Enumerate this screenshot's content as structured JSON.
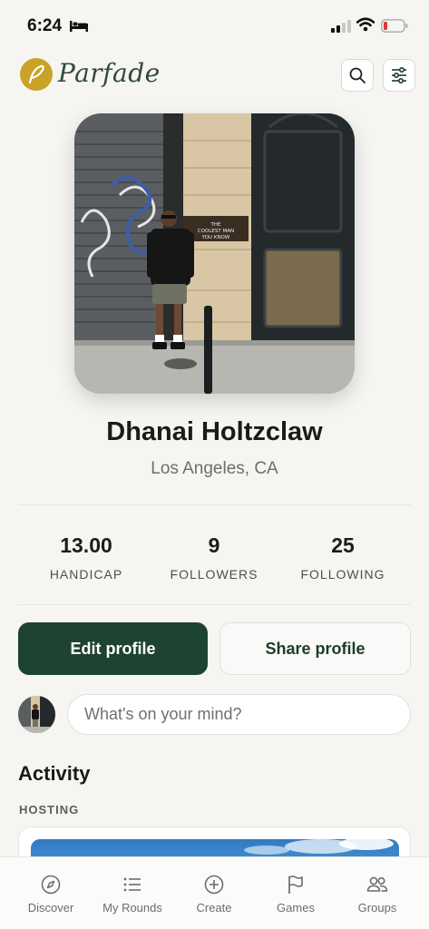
{
  "status_bar": {
    "time": "6:24"
  },
  "app": {
    "name": "Parfade"
  },
  "profile": {
    "name": "Dhanai Holtzclaw",
    "location": "Los Angeles, CA",
    "photo_sign_text": "THE COOLEST MAN YOU KNOW"
  },
  "stats": [
    {
      "value": "13.00",
      "label": "HANDICAP"
    },
    {
      "value": "9",
      "label": "FOLLOWERS"
    },
    {
      "value": "25",
      "label": "FOLLOWING"
    }
  ],
  "actions": {
    "edit": "Edit profile",
    "share": "Share profile"
  },
  "composer": {
    "placeholder": "What's on your mind?"
  },
  "activity": {
    "heading": "Activity",
    "section": "HOSTING"
  },
  "tabs": [
    {
      "label": "Discover",
      "icon": "compass-icon"
    },
    {
      "label": "My Rounds",
      "icon": "list-icon"
    },
    {
      "label": "Create",
      "icon": "plus-circle-icon"
    },
    {
      "label": "Games",
      "icon": "flag-icon"
    },
    {
      "label": "Groups",
      "icon": "people-icon"
    }
  ],
  "colors": {
    "accent_green": "#1e4330",
    "logo_gold": "#c9a227",
    "background": "#f6f5f2",
    "battery_low": "#e0353b"
  }
}
